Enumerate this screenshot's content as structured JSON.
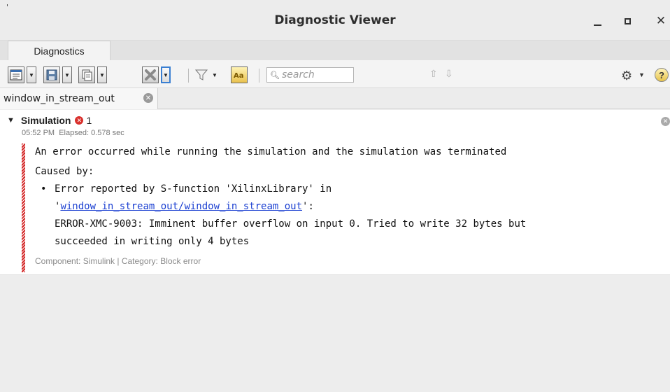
{
  "window": {
    "title": "Diagnostic Viewer"
  },
  "tabs": [
    {
      "label": "Diagnostics"
    }
  ],
  "search": {
    "placeholder": "search"
  },
  "document_tab": {
    "label": "window_in_stream_out"
  },
  "diagnostic": {
    "stage": "Simulation",
    "error_count": "1",
    "time": "05:52 PM",
    "elapsed": "Elapsed: 0.578 sec",
    "message": "An error occurred while running the simulation and the simulation was terminated",
    "caused_by": "Caused by:",
    "cause_bullet": "•",
    "cause_line1": "Error reported by S-function 'XilinxLibrary' in",
    "cause_quote_open": "'",
    "cause_link": "window_in_stream_out/window_in_stream_out",
    "cause_quote_close": "':",
    "cause_line3": "ERROR-XMC-9003: Imminent buffer overflow on input 0. Tried to write 32 bytes but",
    "cause_line4": "succeeded in writing only 4 bytes",
    "component": "Component: Simulink | Category: Block error"
  },
  "colors": {
    "error": "#d9302c",
    "link": "#1a3fd1",
    "accent": "#3a7fd2"
  }
}
